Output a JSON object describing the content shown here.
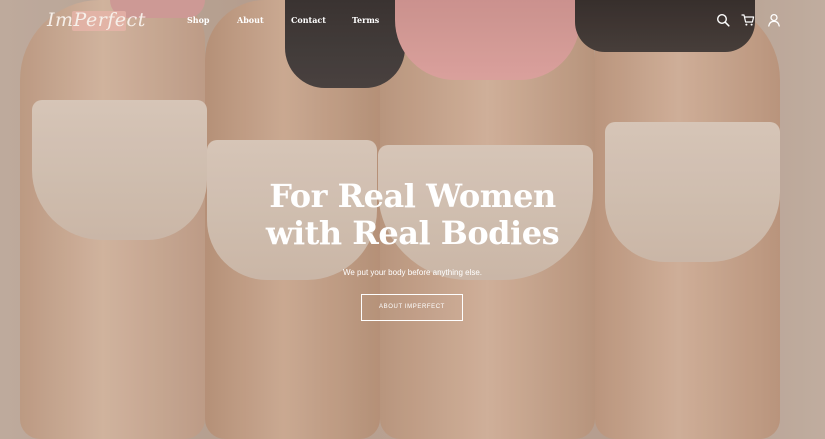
{
  "brand": {
    "logo_text": "ImPerfect"
  },
  "nav": {
    "items": [
      {
        "label": "Shop"
      },
      {
        "label": "About"
      },
      {
        "label": "Contact"
      },
      {
        "label": "Terms"
      }
    ]
  },
  "header_icons": {
    "search": "search-icon",
    "cart": "cart-icon",
    "account": "user-icon"
  },
  "hero": {
    "headline_line_1": "For Real Women",
    "headline_line_2": "with Real Bodies",
    "subtitle": "We put your body before anything else.",
    "cta_label": "ABOUT IMPERFECT"
  },
  "colors": {
    "text": "#ffffff",
    "logo_accent": "#e8b4aa",
    "background": "#c5b3a6"
  }
}
